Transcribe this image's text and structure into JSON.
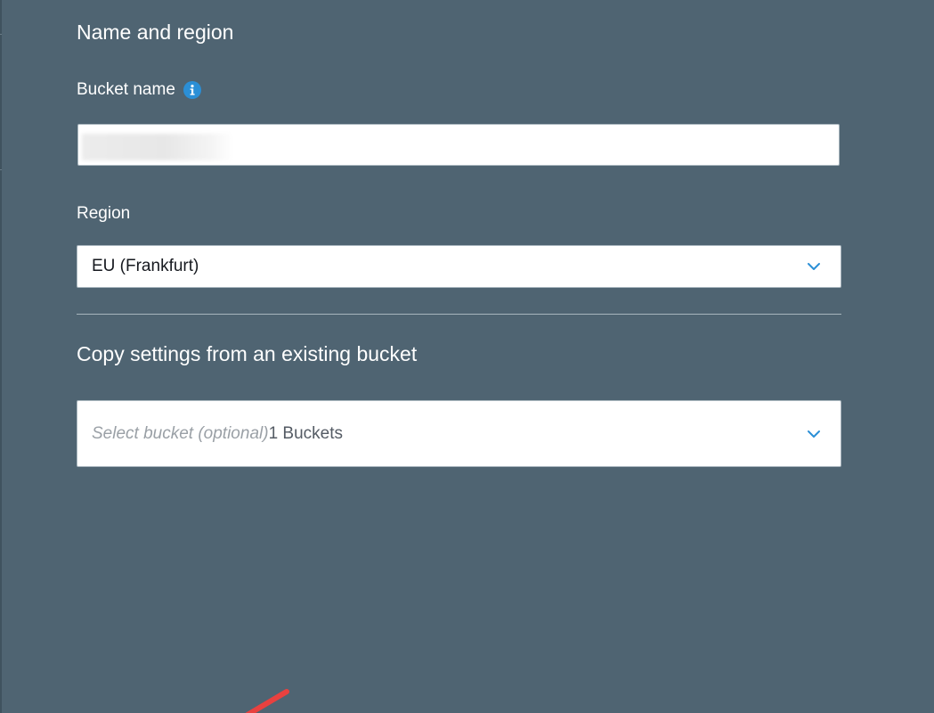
{
  "section": {
    "title": "Name and region"
  },
  "bucket_name": {
    "label": "Bucket name",
    "value": "",
    "info_icon": "info-icon"
  },
  "region": {
    "label": "Region",
    "selected": "EU (Frankfurt)",
    "icon": "chevron-down-icon"
  },
  "copy_settings": {
    "title": "Copy settings from an existing bucket",
    "placeholder": "Select bucket (optional)",
    "count_text": "1 Buckets",
    "icon": "chevron-down-icon"
  },
  "colors": {
    "background": "#4f6472",
    "accent": "#2b8fd6",
    "annotation": "#e8413f"
  }
}
